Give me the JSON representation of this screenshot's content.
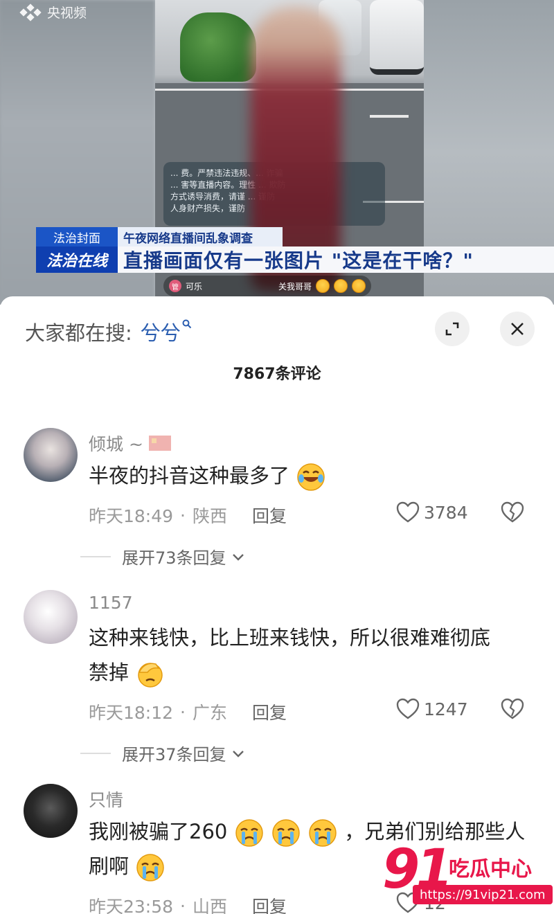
{
  "video": {
    "channel_logo": "央视频",
    "notice_lines": [
      "... 费。严禁违法违规、... 诈骗",
      "... 害等直播内容。理性 ... 欺防",
      "方式诱导消费，请谨 ... 谨防",
      "人身财产损失，谨防"
    ],
    "live_user": "可乐",
    "live_follow": "关我哥哥",
    "tag_program": "法治封面",
    "tag_topic": "午夜网络直播间乱象调查",
    "tag_show": "法治在线",
    "headline": "直播画面仅有一张图片 \"这是在干啥？\""
  },
  "sheet": {
    "search_label": "大家都在搜:",
    "search_term": "兮兮",
    "comment_count_title": "7867条评论",
    "reply_label": "回复"
  },
  "comments": [
    {
      "username": "倾城 ~",
      "has_flag": true,
      "text": "半夜的抖音这种最多了",
      "time": "昨天18:49",
      "location": "陕西",
      "likes": "3784",
      "expand": "展开73条回复"
    },
    {
      "username": "1157",
      "text_line1": "这种来钱快，比上班来钱快，所以很难难彻底",
      "text_line2": "禁掉",
      "time": "昨天18:12",
      "location": "广东",
      "likes": "1247",
      "expand": "展开37条回复"
    },
    {
      "username": "只情",
      "text_line1a": "我刚被骗了260",
      "text_line1b": "，兄弟们别给那些人",
      "text_line2": "刷啊",
      "time": "昨天23:58",
      "location": "山西",
      "likes": "12"
    }
  ],
  "watermark": {
    "logo_number": "91",
    "logo_text": "吃瓜中心",
    "url": "https://91vip21.com"
  },
  "colors": {
    "accent_link": "#2a5db0",
    "watermark_red": "#e8174a",
    "news_blue": "#1b55c6"
  }
}
